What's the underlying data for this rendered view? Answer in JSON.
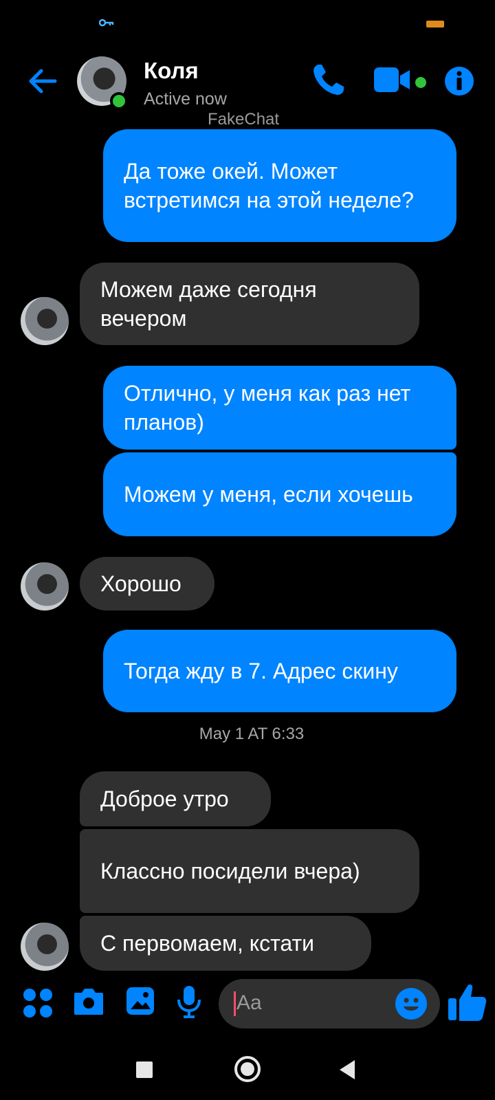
{
  "colors": {
    "accent": "#0084ff",
    "incoming_bubble": "#303030",
    "online": "#31c43b",
    "background": "#000000"
  },
  "header": {
    "name": "Коля",
    "status": "Active now",
    "watermark": "FakeChat",
    "icons": [
      "back-arrow-icon",
      "phone-icon",
      "video-camera-icon",
      "info-icon"
    ]
  },
  "messages": [
    {
      "dir": "out",
      "text": "Да тоже окей. Может встретимся на этой неделе?"
    },
    {
      "dir": "in",
      "text": "Можем даже сегодня вечером"
    },
    {
      "dir": "out",
      "text": "Отлично, у меня как раз нет планов)"
    },
    {
      "dir": "out",
      "text": "Можем у меня, если хочешь"
    },
    {
      "dir": "in",
      "text": "Хорошо"
    },
    {
      "dir": "out",
      "text": "Тогда жду в 7. Адрес скину"
    },
    {
      "dir": "in",
      "text": "Доброе утро"
    },
    {
      "dir": "in",
      "text": "Классно посидели вчера)"
    },
    {
      "dir": "in",
      "text": "С первомаем, кстати"
    }
  ],
  "timestamp": "May 1 AT 6:33",
  "composer": {
    "placeholder": "Aa",
    "icons": [
      "apps-grid-icon",
      "camera-icon",
      "gallery-icon",
      "microphone-icon",
      "emoji-icon",
      "thumbs-up-icon"
    ]
  }
}
